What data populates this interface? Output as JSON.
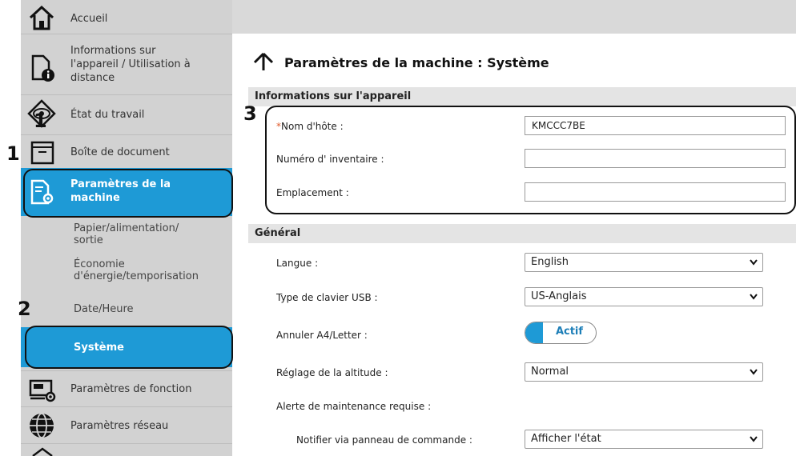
{
  "sidebar": {
    "home": "Accueil",
    "device_info": "Informations sur l'appareil / Utilisation à distance",
    "device_info_lines": [
      "Informations sur",
      "l'appareil / Utilisation à",
      "distance"
    ],
    "job_status": "État du travail",
    "document_box": "Boîte de document",
    "machine_settings_lines": [
      "Paramètres de la",
      "machine"
    ],
    "sub_paper_lines": [
      "Papier/alimentation/",
      "sortie"
    ],
    "sub_energy_lines": [
      "Économie",
      "d'énergie/temporisation"
    ],
    "sub_datetime": "Date/Heure",
    "sub_system": "Système",
    "function_settings": "Paramètres de fonction",
    "network_settings": "Paramètres réseau"
  },
  "page": {
    "title": "Paramètres de la machine : Système",
    "section_device": "Informations sur l'appareil",
    "section_general": "Général"
  },
  "device_info": {
    "required_mark": "*",
    "hostname_label": "Nom d'hôte :",
    "hostname_value": "KMCCC7BE",
    "asset_label": "Numéro d' inventaire :",
    "asset_value": "",
    "location_label": "Emplacement :",
    "location_value": ""
  },
  "general": {
    "language_label": "Langue :",
    "language_value": "English",
    "usb_keyboard_label": "Type de clavier USB :",
    "usb_keyboard_value": "US-Anglais",
    "a4_letter_label": "Annuler A4/Letter  :",
    "a4_letter_toggle": "Actif",
    "altitude_label": "Réglage de la altitude :",
    "altitude_value": "Normal",
    "maintenance_label": "Alerte de maintenance requise :",
    "notify_label": "Notifier via panneau de commande :",
    "notify_value": "Afficher l'état"
  },
  "callouts": {
    "one_a": "1",
    "one_b": "1",
    "two": "2",
    "three": "3"
  },
  "colors": {
    "sidebar_bg": "#d2d2d2",
    "active_blue": "#1e9ad6",
    "section_header_bg": "#e4e4e4",
    "toggle_blue": "#1e9ad6"
  }
}
